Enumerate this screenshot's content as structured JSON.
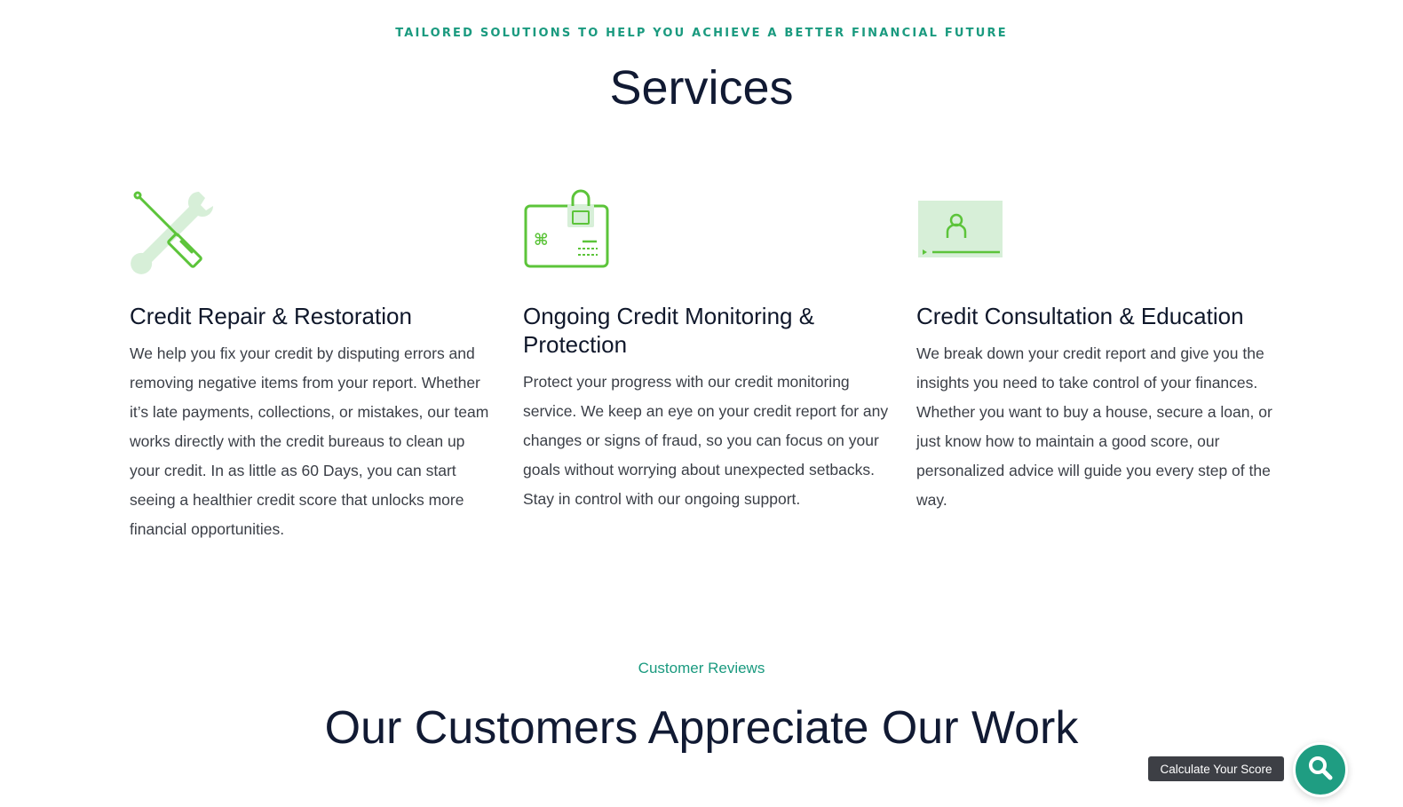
{
  "header": {
    "eyebrow": "TAILORED SOLUTIONS TO HELP YOU ACHIEVE A BETTER FINANCIAL FUTURE",
    "title": "Services"
  },
  "services": [
    {
      "icon": "wrench-screwdriver-icon",
      "title": "Credit Repair & Restoration",
      "body": "We help you fix your credit by disputing errors and removing negative items from your report. Whether it’s late payments, collections, or mistakes, our team works directly with the credit bureaus to clean up your credit. In as little as 60 Days, you can start seeing a healthier credit score that unlocks more financial opportunities."
    },
    {
      "icon": "locked-credit-card-icon",
      "title": "Ongoing Credit Monitoring & Protection",
      "body": "Protect your progress with our credit monitoring service. We keep an eye on your credit report for any changes or signs of fraud, so you can focus on your goals without worrying about unexpected setbacks. Stay in control with our ongoing support."
    },
    {
      "icon": "consultation-screen-icon",
      "title": "Credit Consultation & Education",
      "body": "We break down your credit report and give you the insights you need to take control of your finances. Whether you want to buy a house, secure a loan, or just know how to maintain a good score, our personalized advice will guide you every step of the way."
    }
  ],
  "reviews": {
    "eyebrow": "Customer Reviews",
    "title": "Our Customers Appreciate Our Work"
  },
  "calculator": {
    "label": "Calculate Your Score",
    "icon": "search-icon"
  },
  "colors": {
    "accent_teal": "#1a9a7f",
    "icon_green": "#5cc43a",
    "icon_light_green": "#d7efd8",
    "heading_navy": "#111a33"
  }
}
